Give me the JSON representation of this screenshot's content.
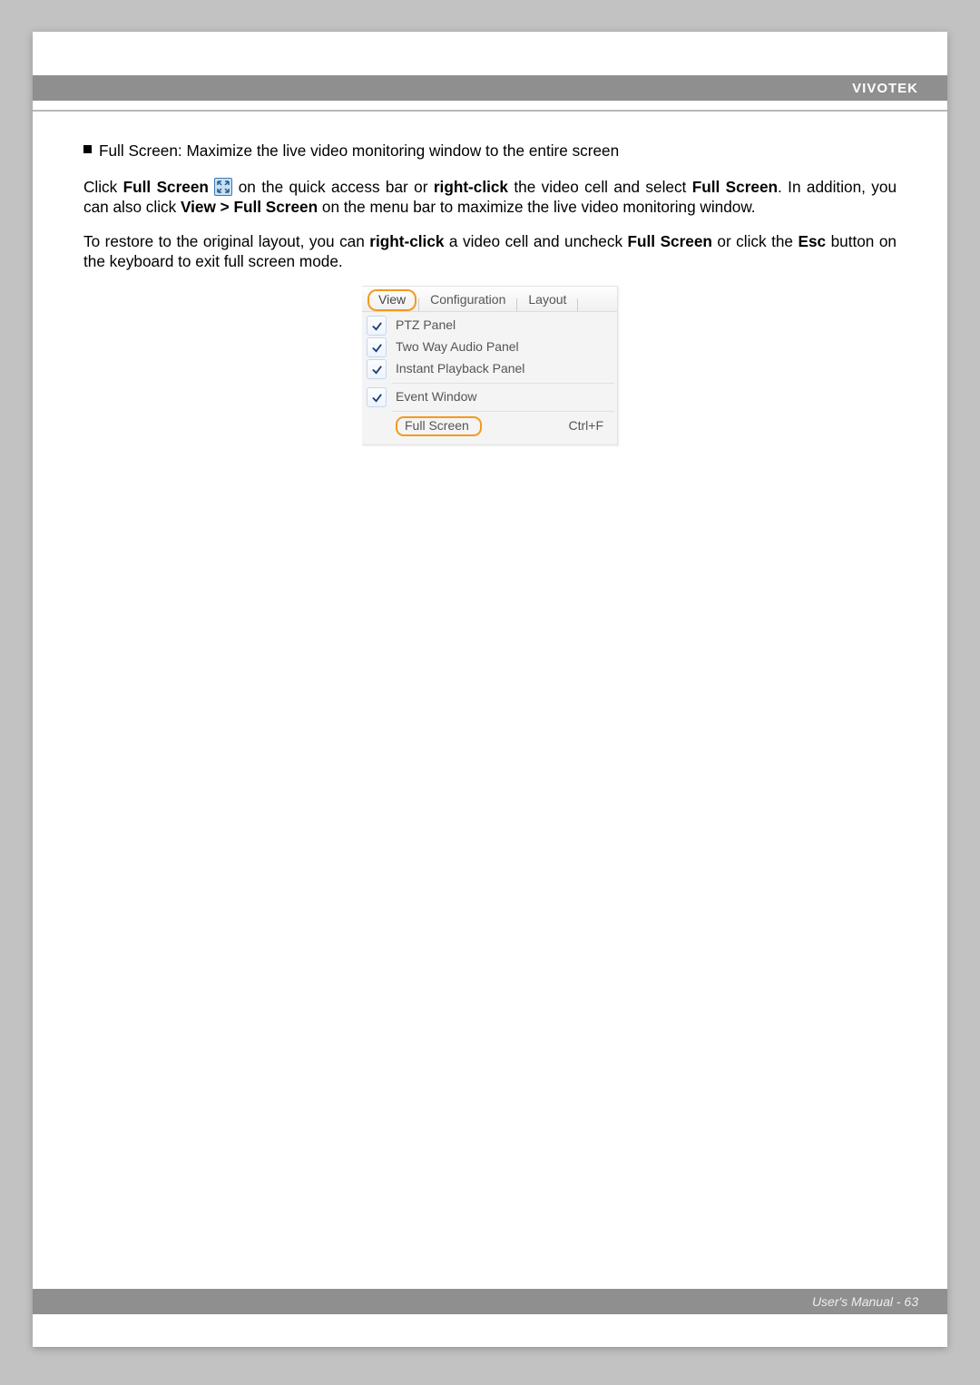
{
  "brand": "VIVOTEK",
  "bullet_heading": "Full Screen: Maximize the live video monitoring window to the entire screen",
  "para1_a": "Click ",
  "para1_b": "Full Screen",
  "para1_c": " ",
  "para1_d": " on the quick access bar or ",
  "para1_e": "right-click",
  "para1_f": " the video cell and select ",
  "para1_g": "Full Screen",
  "para1_h": ". In addition, you can also click ",
  "para1_i": "View > Full Screen",
  "para1_j": " on the menu bar to maximize the live video monitoring window.",
  "para2_a": "To restore to the original layout, you can ",
  "para2_b": "right-click",
  "para2_c": " a video cell and uncheck ",
  "para2_d": "Full Screen",
  "para2_e": " or click the ",
  "para2_f": "Esc",
  "para2_g": " button on the keyboard to exit full screen mode.",
  "menu": {
    "tab_view": "View",
    "tab_config": "Configuration",
    "tab_layout": "Layout",
    "item_ptz": "PTZ Panel",
    "item_twoway": "Two Way Audio Panel",
    "item_instant": "Instant Playback Panel",
    "item_event": "Event Window",
    "item_fullscreen": "Full Screen",
    "shortcut_fullscreen": "Ctrl+F"
  },
  "footer": "User's Manual - 63"
}
